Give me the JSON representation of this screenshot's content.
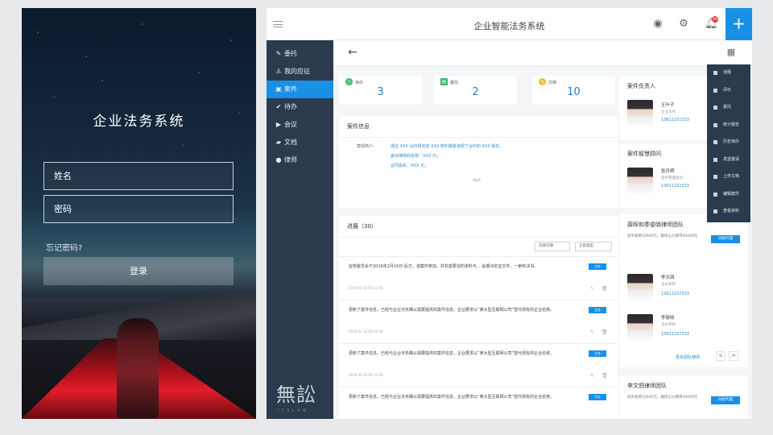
{
  "login": {
    "title": "企业法务系统",
    "username_placeholder": "姓名",
    "password_placeholder": "密码",
    "forgot": "忘记密码?",
    "submit": "登录"
  },
  "app": {
    "title": "企业智能法务系统",
    "notification_count": "10",
    "plus": "+",
    "accent": "#1a8fe6",
    "sidebar_bg": "#2b3b4d"
  },
  "sidebar": {
    "items": [
      {
        "label": "委托",
        "icon": "edit-icon"
      },
      {
        "label": "我的应征",
        "icon": "user-icon"
      },
      {
        "label": "案件",
        "icon": "briefcase-icon"
      },
      {
        "label": "待办",
        "icon": "check-icon"
      },
      {
        "label": "会议",
        "icon": "play-icon"
      },
      {
        "label": "文档",
        "icon": "folder-icon"
      },
      {
        "label": "律师",
        "icon": "person-icon"
      }
    ],
    "logo": "無訟",
    "logo_sub": "ITSLAW"
  },
  "stats": [
    {
      "label": "待办",
      "value": "3",
      "color": "#3cb46e"
    },
    {
      "label": "委托",
      "value": "2",
      "color": "#3cb46e"
    },
    {
      "label": "文档",
      "value": "10",
      "color": "#e8b92a"
    }
  ],
  "case_info": {
    "header": "案件信息",
    "brief_label": "案情简介:",
    "lines": [
      "通过 XXX 合约规定的 XXX 权利或者违规了合约的 XXX 损失。",
      "委派律师的名称：XXX 元；",
      "合同损失：XXX 元。"
    ]
  },
  "progress": {
    "header": "进展（30）",
    "date_filter": "选择日期",
    "type_filter": "全部类型",
    "items": [
      {
        "text": "监管委员会于2016年2月16日 后方，该案件参加，并完善要证的资料与... 会期决定证文件，一审判决书。",
        "time": "2016-02-16 09:12:46",
        "tag": "主办"
      },
      {
        "text": "更新了案件信息，已经与企业法务确认需要提供的案件信息，企业要求以“某大型互联网公司”替代现有的企业名称。",
        "time": "2016-02-16 09:12:46",
        "tag": "主办"
      },
      {
        "text": "更新了案件信息，已经与企业法务确认需要提供的案件信息，企业要求以“某大型互联网公司”替代现有的企业名称。",
        "time": "2016-02-16 09:12:46",
        "tag": "主办"
      },
      {
        "text": "更新了案件信息，已经与企业法务确认需要提供的案件信息，企业要求以“某大型互联网公司”替代现有的企业名称。",
        "time": "",
        "tag": "主办"
      }
    ]
  },
  "case_owner": {
    "header": "案件负责人",
    "name": "王叶子",
    "role": "企业法务",
    "phone": "13611151333"
  },
  "case_counsel": {
    "header": "案件智慧顾问",
    "name": "张月明",
    "role": "案件管理顾问",
    "phone": "13611151333"
  },
  "team1": {
    "header": "薛晖和季俊晓律师团队",
    "desc": "初步收费10000元，最终止价费用40000元",
    "button": "同组代理",
    "members": [
      {
        "name": "李文鸽",
        "role": "主办律师",
        "phone": "13611157333"
      },
      {
        "name": "李俊晓",
        "role": "主办律师",
        "phone": "13611157333"
      }
    ],
    "more": "更多团队律师",
    "prev": "<",
    "next": ">"
  },
  "team2": {
    "header": "李文鸽律师团队",
    "desc": "初步收费10000元，最终止价费用40000元",
    "button": "同组代理"
  },
  "dropdown": {
    "items": [
      "话题",
      "评价",
      "委托",
      "统计报告",
      "历史待办",
      "发送邀请",
      "上传文档",
      "编辑案件",
      "查看资料"
    ]
  }
}
